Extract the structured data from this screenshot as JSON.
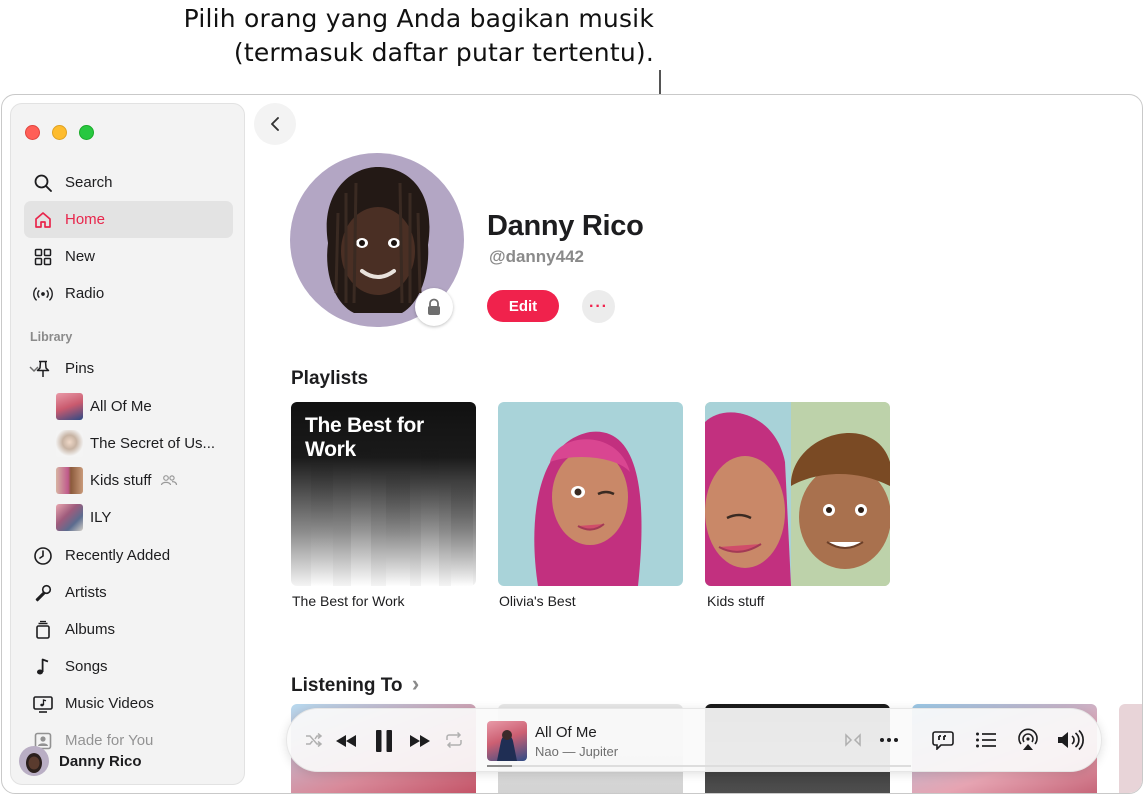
{
  "callout": {
    "line1": "Pilih orang yang Anda bagikan musik",
    "line2": "(termasuk daftar putar tertentu)."
  },
  "sidebar": {
    "items": [
      {
        "label": "Search",
        "icon": "search-icon"
      },
      {
        "label": "Home",
        "icon": "home-icon",
        "active": true
      },
      {
        "label": "New",
        "icon": "grid-icon"
      },
      {
        "label": "Radio",
        "icon": "radio-icon"
      }
    ],
    "library_label": "Library",
    "pins_label": "Pins",
    "pins": [
      {
        "label": "All Of Me"
      },
      {
        "label": "The Secret of Us..."
      },
      {
        "label": "Kids stuff",
        "shared": true
      },
      {
        "label": "ILY"
      }
    ],
    "library_items": [
      {
        "label": "Recently Added",
        "icon": "clock-icon"
      },
      {
        "label": "Artists",
        "icon": "microphone-icon"
      },
      {
        "label": "Albums",
        "icon": "album-icon"
      },
      {
        "label": "Songs",
        "icon": "music-note-icon"
      },
      {
        "label": "Music Videos",
        "icon": "music-video-icon"
      },
      {
        "label": "Made for You",
        "icon": "person-square-icon"
      }
    ],
    "user_name": "Danny Rico"
  },
  "profile": {
    "name": "Danny Rico",
    "handle": "@danny442",
    "edit_label": "Edit",
    "more_label": "···"
  },
  "playlists": {
    "title": "Playlists",
    "items": [
      {
        "name": "The Best for Work",
        "cover_title": "The Best for Work"
      },
      {
        "name": "Olivia's Best"
      },
      {
        "name": "Kids stuff"
      }
    ]
  },
  "listening": {
    "title": "Listening To",
    "chevron": "›"
  },
  "player": {
    "track": "All Of Me",
    "subtitle": "Nao — Jupiter",
    "progress": 0.06
  },
  "colors": {
    "accent": "#f0224c",
    "sidebar_bg": "#f3f3f3"
  }
}
